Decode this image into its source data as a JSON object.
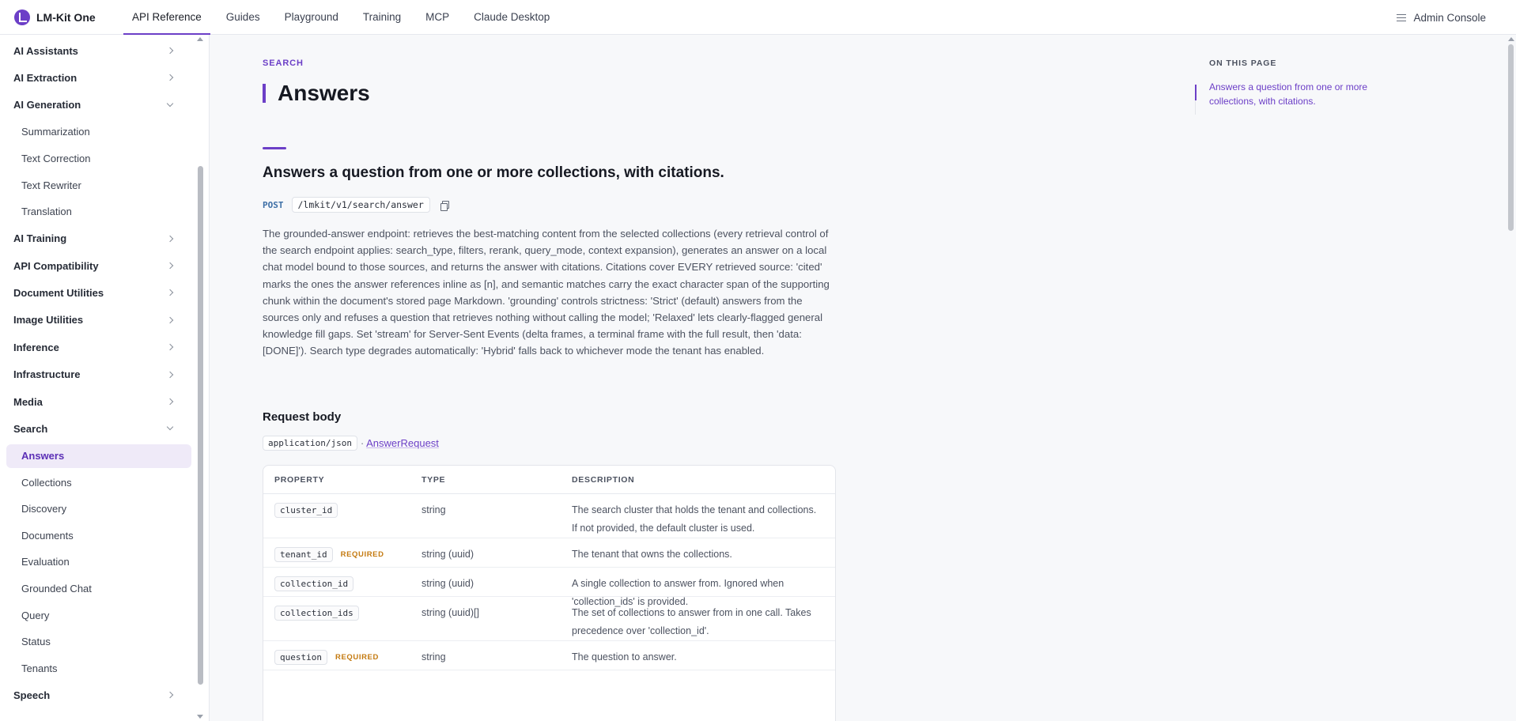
{
  "brand": {
    "name": "LM-Kit One"
  },
  "nav": [
    {
      "label": "API Reference",
      "active": true
    },
    {
      "label": "Guides"
    },
    {
      "label": "Playground"
    },
    {
      "label": "Training"
    },
    {
      "label": "MCP"
    },
    {
      "label": "Claude Desktop"
    }
  ],
  "admin_label": "Admin Console",
  "sidebar": {
    "ai_assistants": "AI Assistants",
    "ai_extraction": "AI Extraction",
    "ai_generation": "AI Generation",
    "summarization": "Summarization",
    "text_correction": "Text Correction",
    "text_rewriter": "Text Rewriter",
    "translation": "Translation",
    "ai_training": "AI Training",
    "api_compatibility": "API Compatibility",
    "document_utilities": "Document Utilities",
    "image_utilities": "Image Utilities",
    "inference": "Inference",
    "infrastructure": "Infrastructure",
    "media": "Media",
    "search": "Search",
    "answers": "Answers",
    "collections": "Collections",
    "discovery": "Discovery",
    "documents": "Documents",
    "evaluation": "Evaluation",
    "grounded_chat": "Grounded Chat",
    "query": "Query",
    "status": "Status",
    "tenants": "Tenants",
    "speech": "Speech"
  },
  "page": {
    "breadcrumb": "SEARCH",
    "title": "Answers",
    "section_title": "Answers a question from one or more collections, with citations.",
    "method": "POST",
    "path": "/lmkit/v1/search/answer",
    "description": "The grounded-answer endpoint: retrieves the best-matching content from the selected collections (every retrieval control of the search endpoint applies: search_type, filters, rerank, query_mode, context expansion), generates an answer on a local chat model bound to those sources, and returns the answer with citations. Citations cover EVERY retrieved source: 'cited' marks the ones the answer references inline as [n], and semantic matches carry the exact character span of the supporting chunk within the document's stored page Markdown. 'grounding' controls strictness: 'Strict' (default) answers from the sources only and refuses a question that retrieves nothing without calling the model; 'Relaxed' lets clearly-flagged general knowledge fill gaps. Set 'stream' for Server-Sent Events (delta frames, a terminal frame with the full result, then 'data: [DONE]'). Search type degrades automatically: 'Hybrid' falls back to whichever mode the tenant has enabled.",
    "request_body_title": "Request body",
    "content_type": "application/json",
    "separator": "·",
    "schema_link": "AnswerRequest"
  },
  "table": {
    "headers": {
      "property": "PROPERTY",
      "type": "TYPE",
      "description": "DESCRIPTION"
    },
    "rows": [
      {
        "name": "cluster_id",
        "required": "",
        "type": "string",
        "description": "The search cluster that holds the tenant and collections. If not provided, the default cluster is used."
      },
      {
        "name": "tenant_id",
        "required": "REQUIRED",
        "type": "string (uuid)",
        "description": "The tenant that owns the collections."
      },
      {
        "name": "collection_id",
        "required": "",
        "type": "string (uuid)",
        "description": "A single collection to answer from. Ignored when 'collection_ids' is provided."
      },
      {
        "name": "collection_ids",
        "required": "",
        "type": "string (uuid)[]",
        "description": "The set of collections to answer from in one call. Takes precedence over 'collection_id'."
      },
      {
        "name": "question",
        "required": "REQUIRED",
        "type": "string",
        "description": "The question to answer."
      }
    ]
  },
  "toc": {
    "title": "ON THIS PAGE",
    "link": "Answers a question from one or more collections, with citations."
  },
  "colors": {
    "accent": "#6c3fc7",
    "required": "#c47a10",
    "method": "#3d6fa6"
  }
}
